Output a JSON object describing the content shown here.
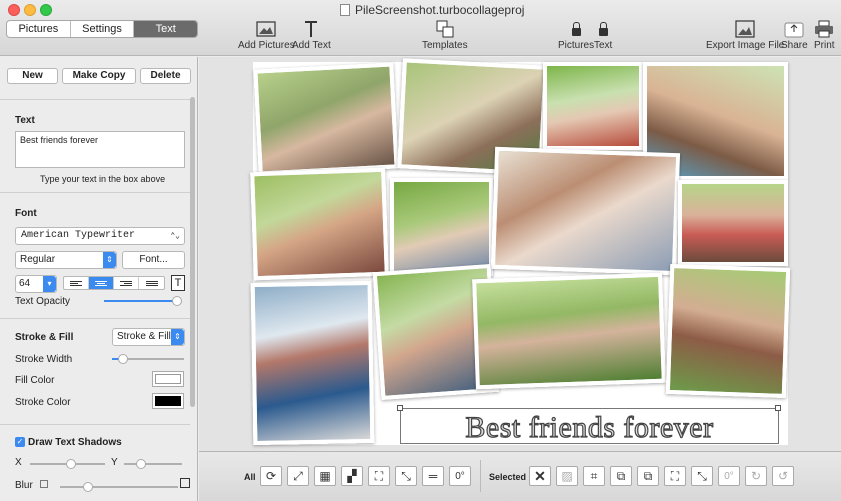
{
  "window": {
    "title": "PileScreenshot.turbocollageproj"
  },
  "tabs": [
    {
      "label": "Pictures"
    },
    {
      "label": "Settings"
    },
    {
      "label": "Text"
    }
  ],
  "toolbar": {
    "add_pictures": "Add Pictures",
    "add_text": "Add Text",
    "templates": "Templates",
    "lock_pictures": "Pictures",
    "lock_text": "Text",
    "export": "Export Image File",
    "share": "Share",
    "print": "Print"
  },
  "sidebar": {
    "new": "New",
    "make_copy": "Make Copy",
    "delete": "Delete",
    "text_heading": "Text",
    "text_value": "Best friends forever",
    "text_hint": "Type your text in the box above",
    "font_heading": "Font",
    "font_family": "American Typewriter",
    "font_style": "Regular",
    "font_button": "Font...",
    "font_size": "64",
    "text_opacity_label": "Text Opacity",
    "text_opacity": 1.0,
    "stroke_heading": "Stroke & Fill",
    "stroke_mode": "Stroke & Fill",
    "stroke_width_label": "Stroke Width",
    "stroke_width": 0.1,
    "fill_color_label": "Fill Color",
    "fill_color": "#ffffff",
    "stroke_color_label": "Stroke Color",
    "stroke_color": "#000000",
    "shadow_label": "Draw Text Shadows",
    "shadow_checked": true,
    "x_label": "X",
    "y_label": "Y",
    "blur_label": "Blur"
  },
  "canvas": {
    "caption": "Best friends forever"
  },
  "bottombar": {
    "all_label": "All",
    "selected_label": "Selected",
    "rotate_label": "0°"
  },
  "colors": {
    "accent": "#3b8af0",
    "active_tab": "#6b6b6b"
  }
}
